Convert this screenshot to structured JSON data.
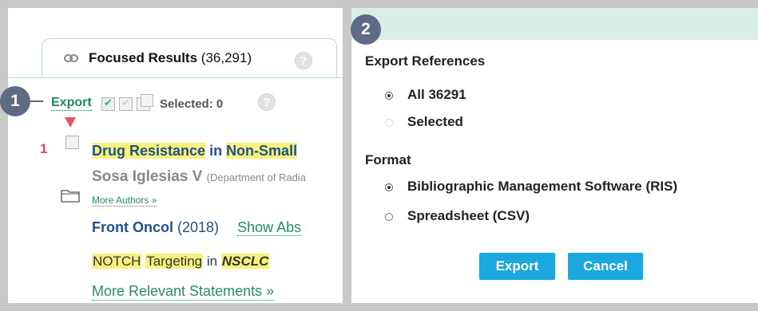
{
  "steps": {
    "one": "1",
    "two": "2"
  },
  "results_tab": {
    "title": "Focused Results",
    "count": "(36,291)",
    "help": "?"
  },
  "toolbar": {
    "export_label": "Export",
    "selected_text": "Selected: 0",
    "help": "?"
  },
  "result": {
    "number": "1",
    "title_part1": "Drug Resistance",
    "title_part2": "in",
    "title_part3": "Non-Small",
    "author": "Sosa Iglesias V",
    "department": "(Department of Radia",
    "more_authors": "More Authors »",
    "journal": "Front Oncol",
    "year": "(2018)",
    "show_abstract": "Show Abs",
    "tag1": "NOTCH",
    "tag2": "Targeting",
    "tag_in": "in",
    "tag3": "NSCLC",
    "more_statements": "More Relevant Statements »"
  },
  "export_dialog": {
    "references_title": "Export References",
    "option_all": "All 36291",
    "option_selected": "Selected",
    "format_title": "Format",
    "format_ris": "Bibliographic Management Software (RIS)",
    "format_csv": "Spreadsheet (CSV)",
    "export_button": "Export",
    "cancel_button": "Cancel"
  },
  "colors": {
    "accent_green": "#1e8a64",
    "link_blue": "#1f4f8c",
    "highlight_yellow": "#f8f27c",
    "button_blue": "#1ba8e0",
    "badge_slate": "#5e6b85",
    "header_mint": "#d8efe9"
  }
}
